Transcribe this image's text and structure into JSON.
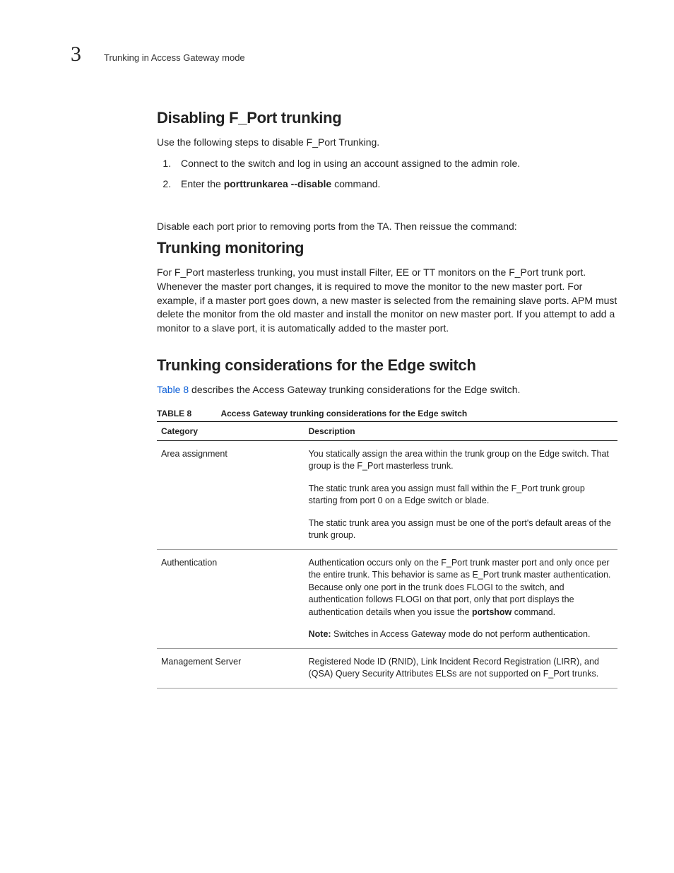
{
  "header": {
    "chapter": "3",
    "breadcrumb": "Trunking in Access Gateway mode"
  },
  "section1": {
    "title": "Disabling F_Port trunking",
    "intro": "Use the following steps to disable F_Port Trunking.",
    "step1": "Connect to the switch and log in using an account assigned to the admin role.",
    "step2a": "Enter the ",
    "step2b": "porttrunkarea --disable",
    "step2c": " command.",
    "after": "Disable each port prior to removing ports from the TA. Then reissue the command:"
  },
  "section2": {
    "title": "Trunking monitoring",
    "body": "For F_Port masterless trunking, you must install Filter, EE or TT monitors on the F_Port trunk port. Whenever the master port changes, it is required to move the monitor to the new master port. For example, if a master port goes down, a new master is selected from the remaining slave ports. APM must delete the monitor from the old master and install the monitor on new master port. If you attempt to add a monitor to a slave port, it is automatically added to the master port."
  },
  "section3": {
    "title": "Trunking considerations for the Edge switch",
    "intro_link": "Table 8",
    "intro_rest": " describes the Access Gateway trunking considerations for the Edge switch.",
    "table_label": "TABLE 8",
    "table_title": "Access Gateway trunking considerations for the Edge switch",
    "col1": "Category",
    "col2": "Description",
    "rows": {
      "r0": {
        "cat": "Area assignment",
        "p1": "You statically assign the area within the trunk group on the Edge switch. That group is the F_Port masterless trunk.",
        "p2": "The static trunk area you assign must fall within the F_Port trunk group starting from port 0 on a Edge switch or blade.",
        "p3": "The static trunk area you assign must be one of the port's default areas of the trunk group."
      },
      "r1": {
        "cat": "Authentication",
        "p1a": "Authentication occurs only on the F_Port trunk master port and only once per the entire trunk. This behavior is same as E_Port trunk master authentication. Because only one port in the trunk does FLOGI to the switch, and authentication follows FLOGI on that port, only that port displays the authentication details when you issue the ",
        "p1b": "portshow",
        "p1c": " command.",
        "note_label": "Note:",
        "note_body": " Switches in Access Gateway mode do not perform authentication."
      },
      "r2": {
        "cat": "Management Server",
        "p1": "Registered Node ID (RNID), Link Incident Record Registration (LIRR), and (QSA) Query Security Attributes ELSs are not supported on F_Port trunks."
      }
    }
  }
}
